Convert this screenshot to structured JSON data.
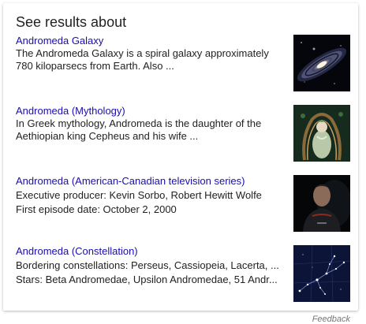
{
  "heading": "See results about",
  "results": [
    {
      "title": "Andromeda Galaxy",
      "lines": [
        "The Andromeda Galaxy is a spiral galaxy approximately",
        "780 kiloparsecs from Earth. Also ..."
      ],
      "image": "spiral-galaxy-image"
    },
    {
      "title": "Andromeda (Mythology)",
      "lines": [
        "In Greek mythology, Andromeda is the daughter of the",
        "Aethiopian king Cepheus and his wife ..."
      ],
      "image": "mythology-painting-image"
    },
    {
      "title": "Andromeda (American-Canadian television series)",
      "lines": [
        "Executive producer: Kevin Sorbo, Robert Hewitt Wolfe",
        "First episode date: October 2, 2000"
      ],
      "image": "tv-series-portrait-image"
    },
    {
      "title": "Andromeda (Constellation)",
      "lines": [
        "Bordering constellations: Perseus, Cassiopeia, Lacerta, ...",
        "Stars: Beta Andromedae, Upsilon Andromedae, 51 Andr..."
      ],
      "image": "star-chart-image"
    }
  ],
  "feedback": "Feedback",
  "colors": {
    "link": "#1a0dab",
    "text": "#222222",
    "muted": "#777777"
  }
}
